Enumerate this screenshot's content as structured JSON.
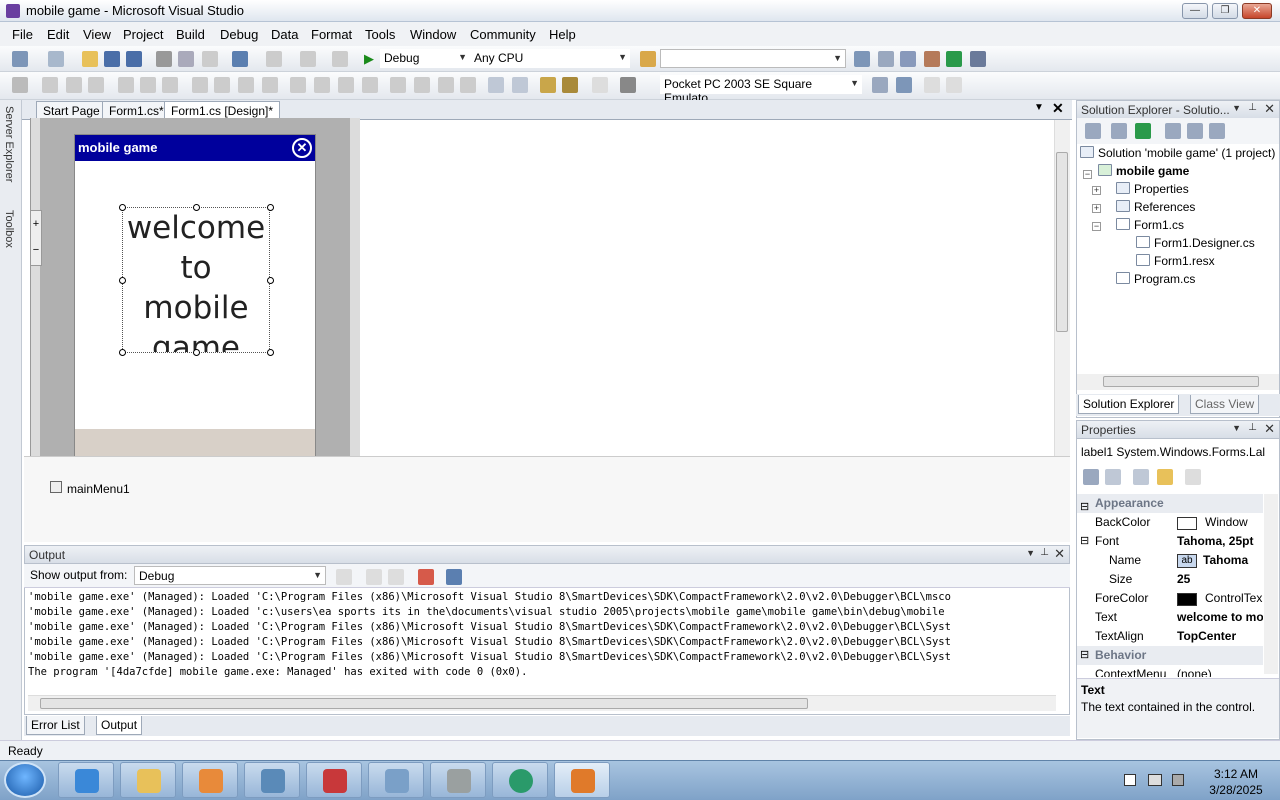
{
  "window": {
    "title": "mobile game - Microsoft Visual Studio"
  },
  "menu": [
    "File",
    "Edit",
    "View",
    "Project",
    "Build",
    "Debug",
    "Data",
    "Format",
    "Tools",
    "Window",
    "Community",
    "Help"
  ],
  "toolbar": {
    "config": "Debug",
    "platform": "Any CPU",
    "device": "Pocket PC 2003 SE Square Emulato"
  },
  "left_dock": {
    "server_explorer": "Server Explorer",
    "toolbox": "Toolbox"
  },
  "doc_tabs": [
    "Start Page",
    "Form1.cs*",
    "Form1.cs [Design]*"
  ],
  "form": {
    "title": "mobile game",
    "label_text": "welcome to mobile game"
  },
  "tray": {
    "component": "mainMenu1"
  },
  "output": {
    "title": "Output",
    "show_from_label": "Show output from:",
    "show_from_value": "Debug",
    "lines": [
      "'mobile game.exe' (Managed): Loaded 'C:\\Program Files (x86)\\Microsoft Visual Studio 8\\SmartDevices\\SDK\\CompactFramework\\2.0\\v2.0\\Debugger\\BCL\\msco",
      "'mobile game.exe' (Managed): Loaded 'c:\\users\\ea sports its in the\\documents\\visual studio 2005\\projects\\mobile game\\mobile game\\bin\\debug\\mobile",
      "'mobile game.exe' (Managed): Loaded 'C:\\Program Files (x86)\\Microsoft Visual Studio 8\\SmartDevices\\SDK\\CompactFramework\\2.0\\v2.0\\Debugger\\BCL\\Syst",
      "'mobile game.exe' (Managed): Loaded 'C:\\Program Files (x86)\\Microsoft Visual Studio 8\\SmartDevices\\SDK\\CompactFramework\\2.0\\v2.0\\Debugger\\BCL\\Syst",
      "'mobile game.exe' (Managed): Loaded 'C:\\Program Files (x86)\\Microsoft Visual Studio 8\\SmartDevices\\SDK\\CompactFramework\\2.0\\v2.0\\Debugger\\BCL\\Syst",
      "The program '[4da7cfde] mobile game.exe: Managed' has exited with code 0 (0x0)."
    ]
  },
  "bottom_tabs": [
    "Error List",
    "Output"
  ],
  "status": "Ready",
  "solution_explorer": {
    "title": "Solution Explorer - Solutio...",
    "solution": "Solution 'mobile game' (1 project)",
    "project": "mobile game",
    "items": [
      "Properties",
      "References",
      "Form1.cs",
      "Form1.Designer.cs",
      "Form1.resx",
      "Program.cs"
    ],
    "tabs": [
      "Solution Explorer",
      "Class View"
    ]
  },
  "properties": {
    "title": "Properties",
    "object": "label1 System.Windows.Forms.Lal",
    "rows": [
      {
        "name": "Appearance",
        "value": "",
        "category": true
      },
      {
        "name": "BackColor",
        "value": "Window"
      },
      {
        "name": "Font",
        "value": "Tahoma, 25pt"
      },
      {
        "name": "Name",
        "value": "Tahoma"
      },
      {
        "name": "Size",
        "value": "25"
      },
      {
        "name": "ForeColor",
        "value": "ControlTex"
      },
      {
        "name": "Text",
        "value": "welcome to mo"
      },
      {
        "name": "TextAlign",
        "value": "TopCenter"
      },
      {
        "name": "Behavior",
        "value": "",
        "category": true
      },
      {
        "name": "ContextMenu",
        "value": "(none)"
      }
    ],
    "desc_title": "Text",
    "desc_text": "The text contained in the control."
  },
  "clock": {
    "time": "3:12 AM",
    "date": "3/28/2025"
  }
}
